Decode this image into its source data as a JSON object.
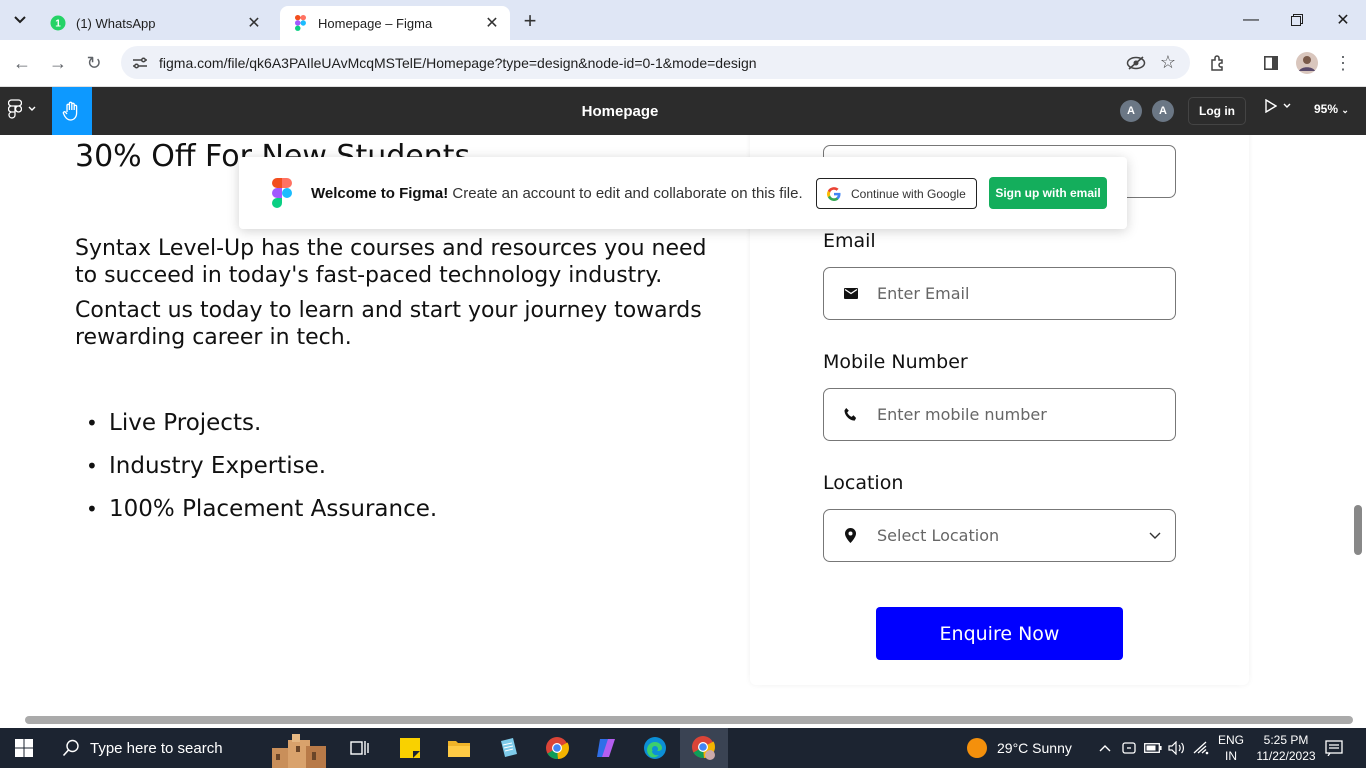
{
  "browser": {
    "tabs": [
      {
        "title": "(1) WhatsApp",
        "badge": "1"
      },
      {
        "title": "Homepage – Figma"
      }
    ],
    "url": "figma.com/file/qk6A3PAIleUAvMcqMSTelE/Homepage?type=design&node-id=0-1&mode=design"
  },
  "figma": {
    "file_title": "Homepage",
    "avatars": [
      "A",
      "A"
    ],
    "login_label": "Log in",
    "zoom": "95%",
    "accent": "#0d99ff"
  },
  "toast": {
    "bold": "Welcome to Figma!",
    "message": " Create an account to edit and collaborate on this file.",
    "google_label": "Continue with Google",
    "email_label": "Sign up with email"
  },
  "design": {
    "heading": "30% Off For New Students",
    "para1": "Syntax Level-Up has the courses and resources you need to succeed in today's fast-paced technology industry.",
    "para2": "Contact us today to learn and start your journey towards rewarding career in tech.",
    "bullets": [
      "Live Projects.",
      "Industry Expertise.",
      "100% Placement Assurance."
    ],
    "form": {
      "email_label": "Email",
      "email_placeholder": "Enter Email",
      "mobile_label": "Mobile Number",
      "mobile_placeholder": "Enter mobile number",
      "location_label": "Location",
      "location_placeholder": "Select Location",
      "submit_label": "Enquire Now",
      "submit_color": "#0000ff"
    }
  },
  "taskbar": {
    "search_placeholder": "Type here to search",
    "weather": "29°C  Sunny",
    "lang_line1": "ENG",
    "lang_line2": "IN",
    "time": "5:25 PM",
    "date": "11/22/2023"
  }
}
